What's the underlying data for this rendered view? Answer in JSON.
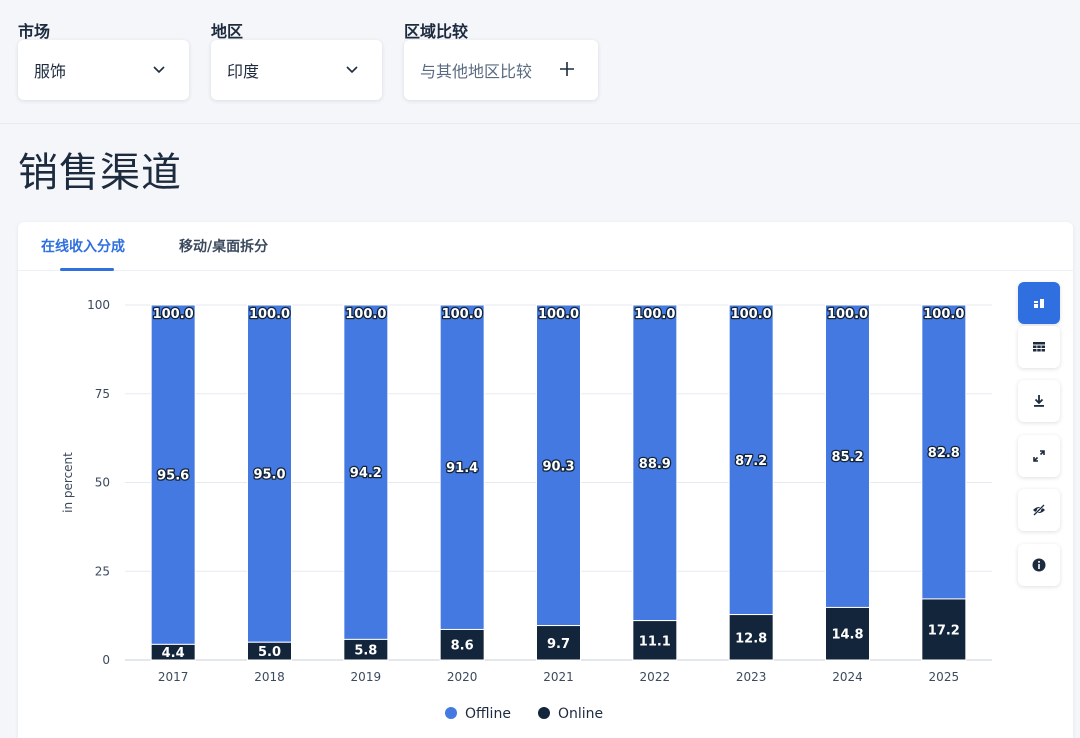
{
  "filters": {
    "market": {
      "label": "市场",
      "value": "服饰"
    },
    "region": {
      "label": "地区",
      "value": "印度"
    },
    "compare": {
      "label": "区域比较",
      "value": "与其他地区比较"
    }
  },
  "page_title": "销售渠道",
  "tabs": [
    {
      "label": "在线收入分成",
      "active": true
    },
    {
      "label": "移动/桌面拆分",
      "active": false
    }
  ],
  "colors": {
    "offline": "#4579e2",
    "online": "#13253b",
    "accent": "#2f6fe0"
  },
  "tools": [
    "chart-view-icon",
    "table-view-icon",
    "download-icon",
    "expand-icon",
    "hide-icon",
    "info-icon"
  ],
  "chart_data": {
    "type": "bar",
    "stacked": true,
    "categories": [
      "2017",
      "2018",
      "2019",
      "2020",
      "2021",
      "2022",
      "2023",
      "2024",
      "2025"
    ],
    "series": [
      {
        "name": "Online",
        "values": [
          4.4,
          5.0,
          5.8,
          8.6,
          9.7,
          11.1,
          12.8,
          14.8,
          17.2
        ]
      },
      {
        "name": "Offline",
        "values": [
          95.6,
          95.0,
          94.2,
          91.4,
          90.3,
          88.9,
          87.2,
          85.2,
          82.8
        ]
      }
    ],
    "total_labels": [
      "100.0",
      "100.0",
      "100.0",
      "100.0",
      "100.0",
      "100.0",
      "100.0",
      "100.0",
      "100.0"
    ],
    "ylabel": "in percent",
    "xlabel": "",
    "ylim": [
      0,
      100
    ],
    "yticks": [
      0,
      25,
      50,
      75,
      100
    ],
    "grid": true,
    "legend": "bottom-center",
    "legend_entries": [
      "Offline",
      "Online"
    ]
  }
}
